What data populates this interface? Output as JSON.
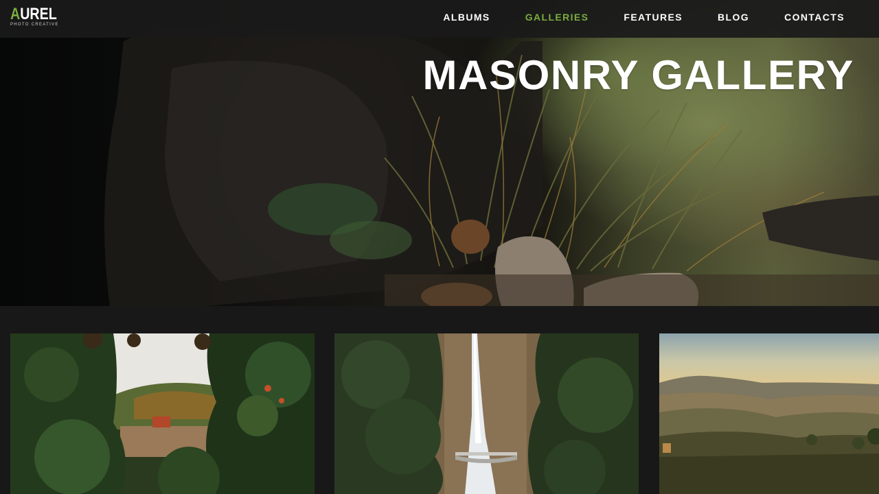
{
  "logo": {
    "accent_letter": "A",
    "rest": "UREL",
    "tagline": "PHOTO CREATIVE"
  },
  "nav": {
    "items": [
      {
        "label": "ALBUMS",
        "active": false
      },
      {
        "label": "GALLERIES",
        "active": true
      },
      {
        "label": "FEATURES",
        "active": false
      },
      {
        "label": "BLOG",
        "active": false
      },
      {
        "label": "CONTACTS",
        "active": false
      }
    ]
  },
  "hero": {
    "title": "MASONRY GALLERY"
  },
  "colors": {
    "accent": "#7aad3f",
    "header_bg": "#1a1a1a",
    "page_bg": "#181818",
    "text": "#ffffff"
  }
}
